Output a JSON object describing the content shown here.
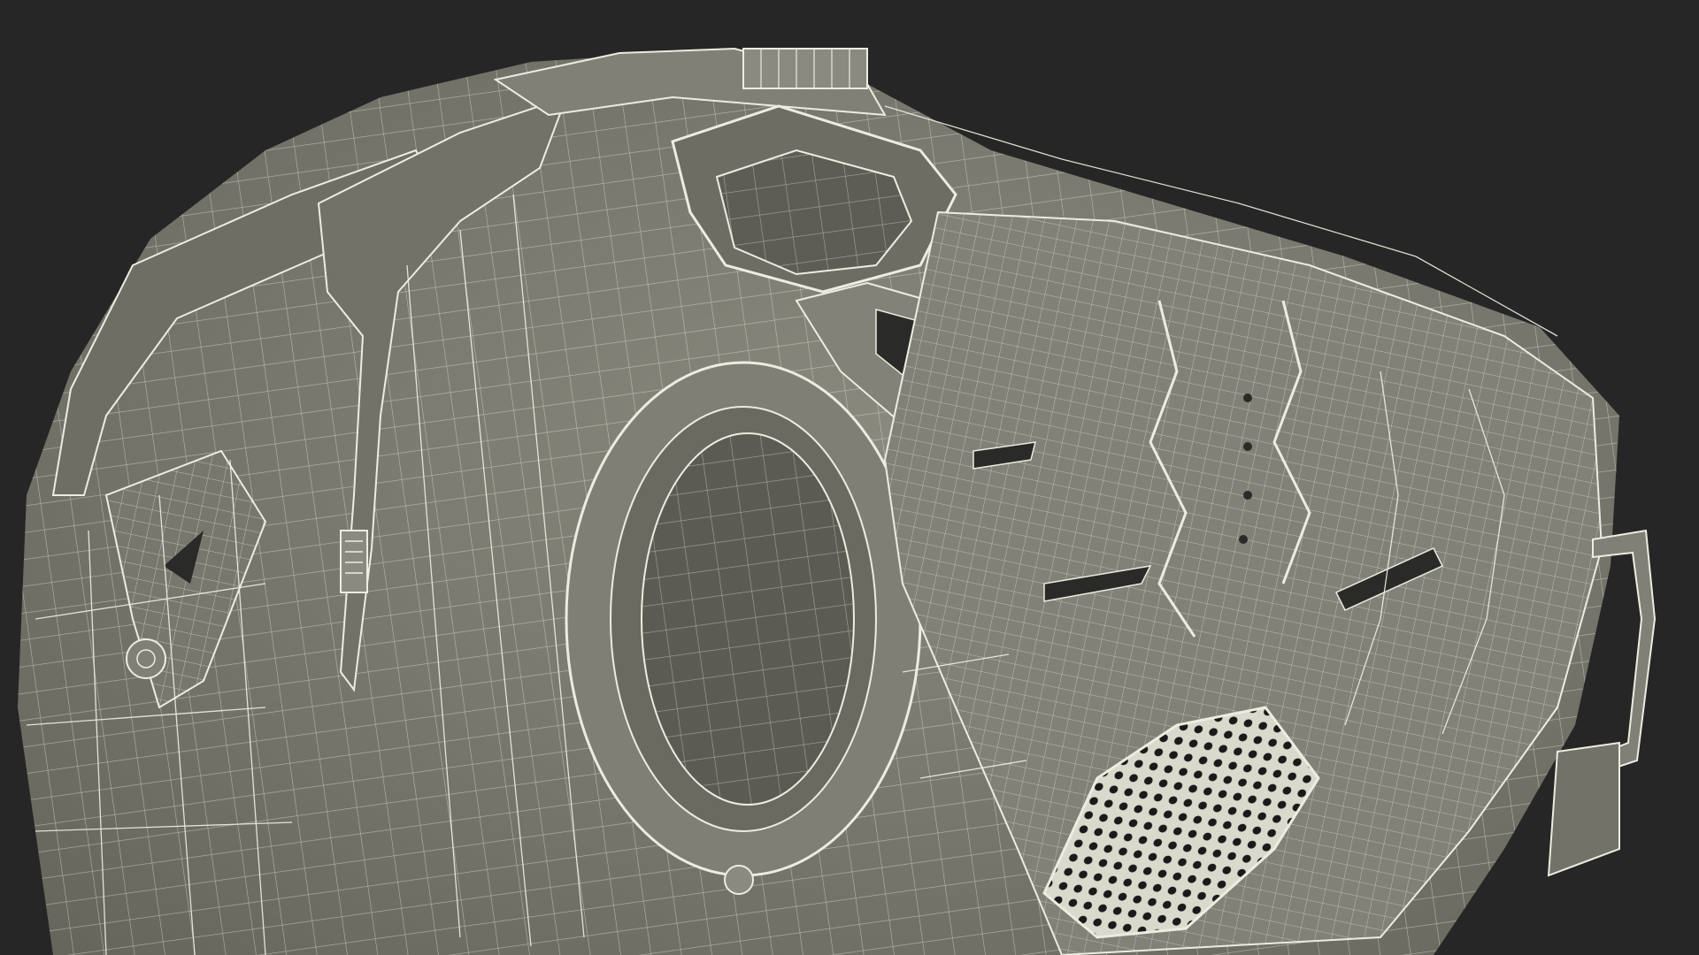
{
  "scene": {
    "subject": "helmet-wireframe-render",
    "colors": {
      "background": "#262626",
      "surface": "#7b7b70",
      "surface_dark": "#5f5f56",
      "surface_light": "#8b8b80",
      "wire": "#f2f2e4",
      "hole": "#1c1c1c"
    }
  }
}
